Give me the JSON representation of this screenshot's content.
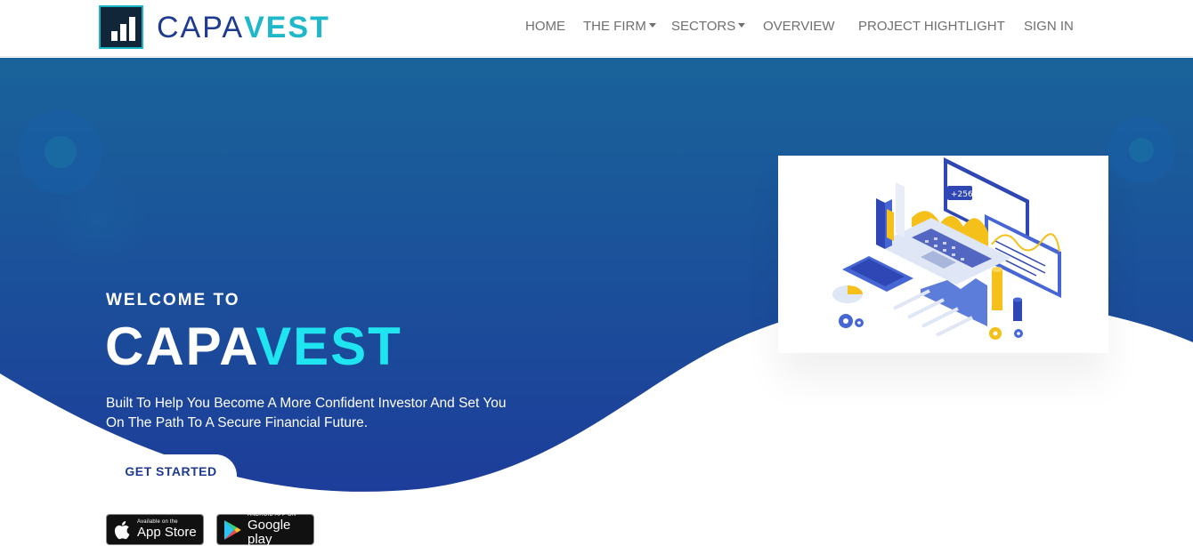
{
  "brand": {
    "part1": "CAPA",
    "part2": "VEST",
    "logo_icon": "bar-chart-icon"
  },
  "nav": {
    "home": "HOME",
    "firm": "THE FIRM",
    "sectors": "SECTORS",
    "overview": "OVERVIEW",
    "project": "PROJECT HIGHTLIGHT",
    "signin": "SIGN IN"
  },
  "hero": {
    "welcome": "WELCOME TO",
    "title_part1": "CAPA",
    "title_part2": "VEST",
    "tagline": "Built To Help You Become A More Confident Investor And Set You On The Path To A Secure Financial Future.",
    "cta": "GET STARTED",
    "illustration_labels": [
      "+256"
    ]
  },
  "stores": {
    "apple_small": "Available on the",
    "apple_big": "App Store",
    "apple_icon": "apple-icon",
    "google_small": "ANDROID APP ON",
    "google_big": "Google play",
    "google_icon": "google-play-icon"
  },
  "colors": {
    "hero_top": "#19639a",
    "hero_bottom": "#1d3d9a",
    "accent_cyan": "#1ee5f0",
    "logo_blue": "#1f3b91",
    "logo_teal": "#1fb8c9",
    "nav_text": "#6f6f6f"
  }
}
